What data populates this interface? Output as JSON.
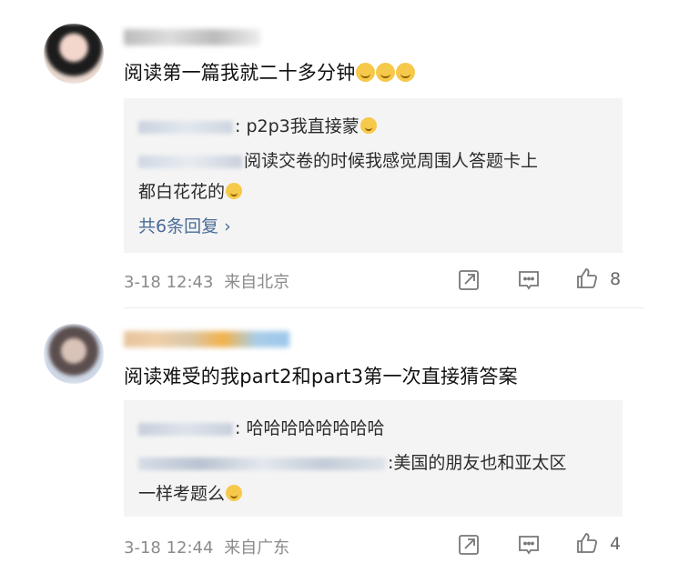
{
  "comments": [
    {
      "text": "阅读第一篇我就二十多分钟",
      "replies": [
        {
          "text": ": p2p3我直接蒙"
        },
        {
          "line1": "阅读交卷的时候我感觉周围人答题卡上",
          "line2": "都白花花的"
        }
      ],
      "more_label": "共6条回复 ›",
      "time": "3-18 12:43",
      "location": "来自北京",
      "likes": "8"
    },
    {
      "text": "阅读难受的我part2和part3第一次直接猜答案",
      "replies": [
        {
          "text": ": 哈哈哈哈哈哈哈哈"
        },
        {
          "line1": ":美国的朋友也和亚太区",
          "line2": "一样考题么"
        }
      ],
      "time": "3-18 12:44",
      "location": "来自广东",
      "likes": "4"
    }
  ],
  "icons": {
    "share": "share-icon",
    "comment": "comment-icon",
    "like": "thumbs-up-icon"
  }
}
